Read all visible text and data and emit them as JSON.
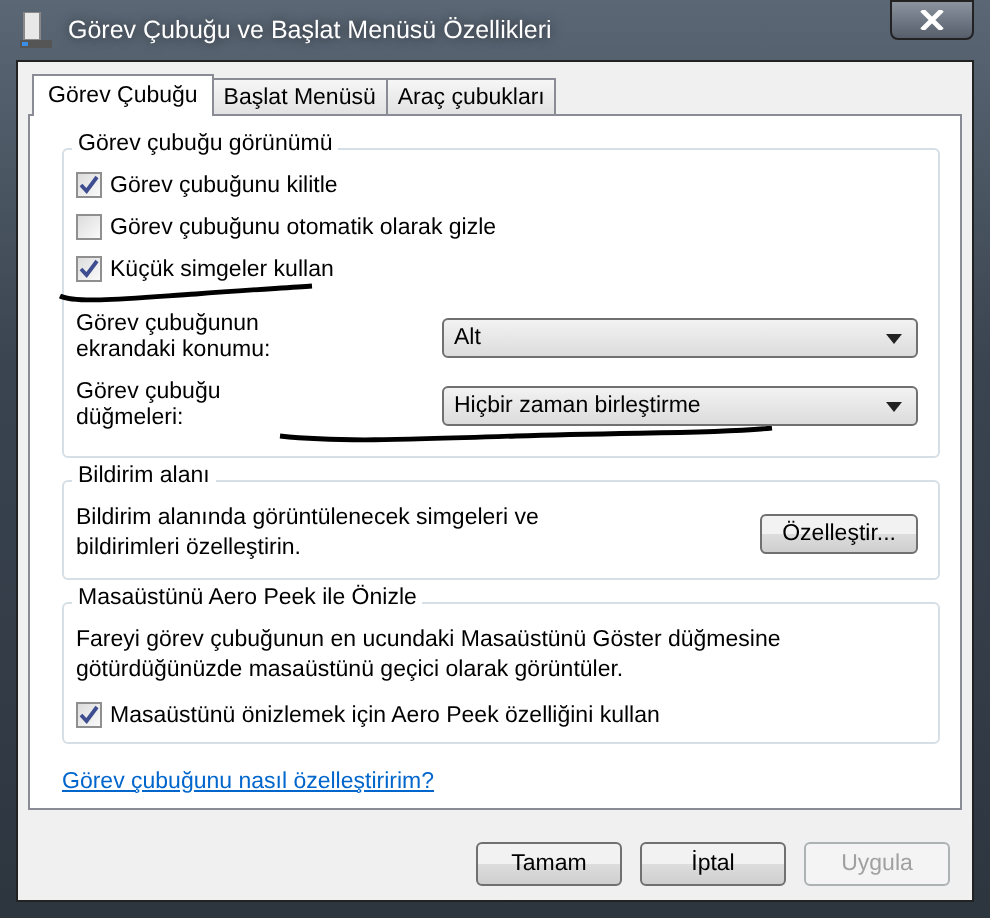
{
  "window": {
    "title": "Görev Çubuğu ve Başlat Menüsü Özellikleri"
  },
  "tabs": [
    {
      "label": "Görev Çubuğu",
      "selected": true
    },
    {
      "label": "Başlat Menüsü",
      "selected": false
    },
    {
      "label": "Araç çubukları",
      "selected": false
    }
  ],
  "groups": [
    {
      "title": "Görev çubuğu görünümü",
      "items": [
        {
          "kind": "checkbox",
          "label": "Görev çubuğunu kilitle",
          "checked": true
        },
        {
          "kind": "checkbox",
          "label": "Görev çubuğunu otomatik olarak gizle",
          "checked": false
        },
        {
          "kind": "checkbox",
          "label": "Küçük simgeler kullan",
          "checked": true
        },
        {
          "kind": "dropdown",
          "label": "Görev çubuğunun ekrandaki konumu:",
          "value": "Alt"
        },
        {
          "kind": "dropdown",
          "label": "Görev çubuğu düğmeleri:",
          "value": "Hiçbir zaman birleştirme"
        }
      ]
    },
    {
      "title": "Bildirim alanı",
      "items": [
        {
          "kind": "text_button",
          "text": "Bildirim alanında görüntülenecek simgeleri ve bildirimleri özelleştirin.",
          "button": "Özelleştir..."
        }
      ]
    },
    {
      "title": "Masaüstünü Aero Peek ile Önizle",
      "items": [
        {
          "kind": "text",
          "text": "Fareyi görev çubuğunun en ucundaki Masaüstünü Göster düğmesine götürdüğünüzde masaüstünü geçici olarak görüntüler."
        },
        {
          "kind": "checkbox",
          "label": "Masaüstünü önizlemek için Aero Peek özelliğini kullan",
          "checked": true
        }
      ]
    }
  ],
  "link": "Görev çubuğunu nasıl özelleştiririm?",
  "buttons": [
    {
      "label": "Tamam",
      "disabled": false
    },
    {
      "label": "İptal",
      "disabled": false
    },
    {
      "label": "Uygula",
      "disabled": true
    }
  ]
}
